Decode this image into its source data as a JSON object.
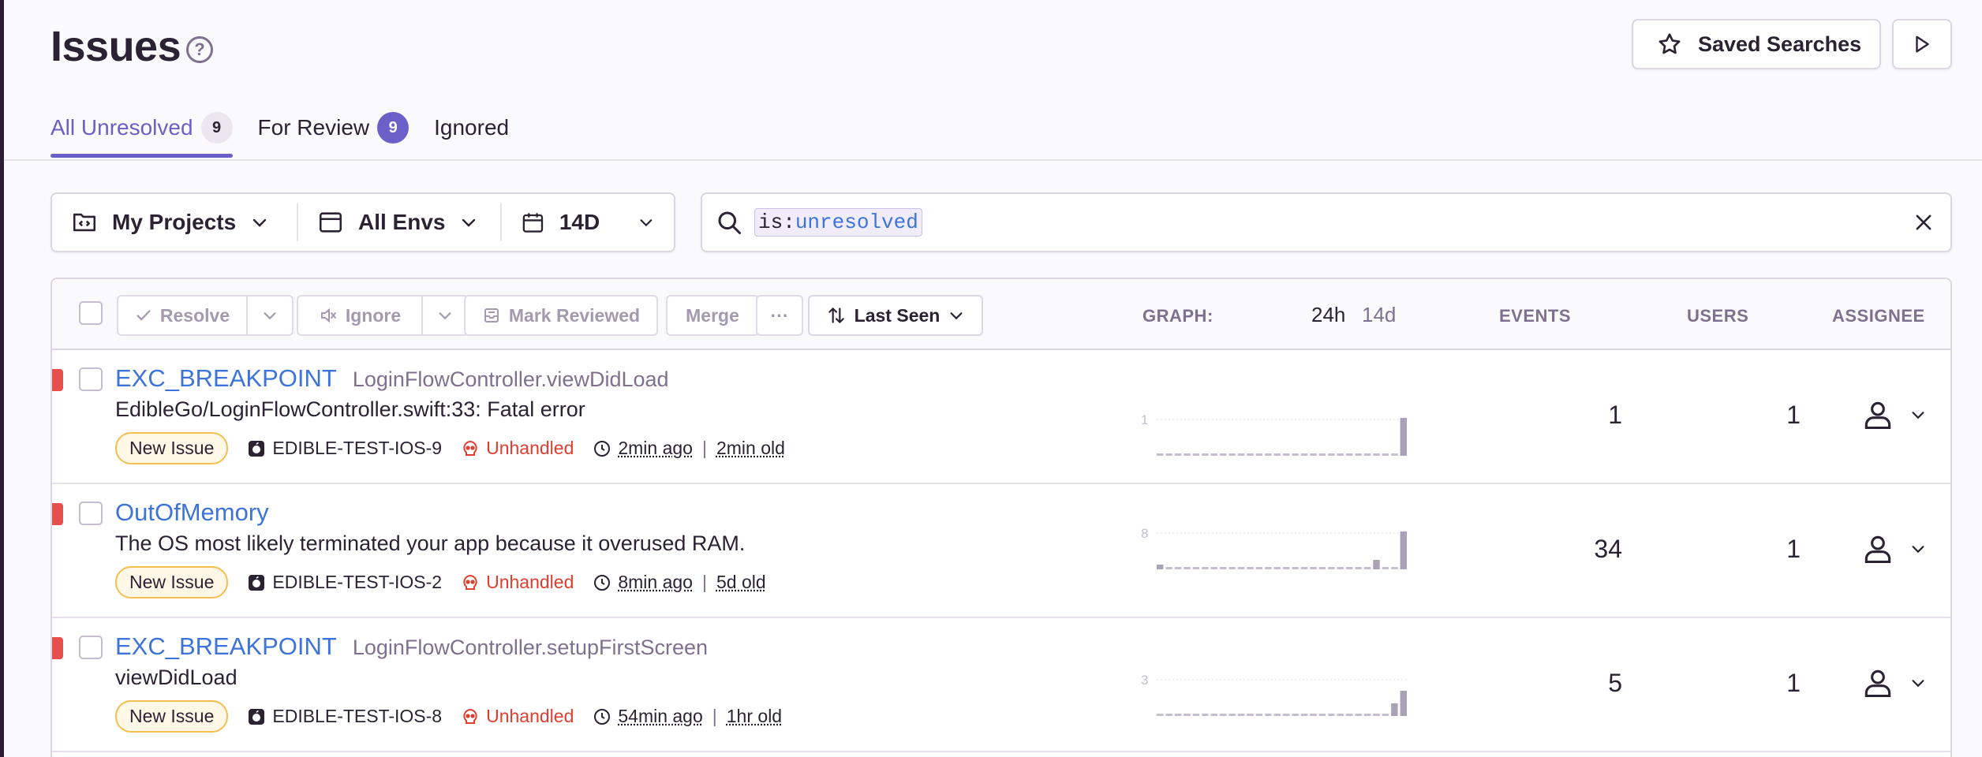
{
  "page": {
    "title": "Issues"
  },
  "header": {
    "saved_searches_label": "Saved Searches"
  },
  "tabs": [
    {
      "label": "All Unresolved",
      "count": "9"
    },
    {
      "label": "For Review",
      "count": "9"
    },
    {
      "label": "Ignored"
    }
  ],
  "filters": {
    "projects": "My Projects",
    "envs": "All Envs",
    "period": "14D"
  },
  "search": {
    "key": "is:",
    "value": "unresolved"
  },
  "toolbar": {
    "resolve": "Resolve",
    "ignore": "Ignore",
    "mark_reviewed": "Mark Reviewed",
    "merge": "Merge",
    "more": "···",
    "sort": "Last Seen"
  },
  "columns": {
    "graph": "GRAPH:",
    "period_24h": "24h",
    "period_14d": "14d",
    "events": "EVENTS",
    "users": "USERS",
    "assignee": "ASSIGNEE"
  },
  "colors": {
    "accent": "#6c5fc7",
    "link": "#3d74db",
    "error": "#e5504c",
    "unhandled": "#e03e2f"
  },
  "issues": [
    {
      "type": "EXC_BREAKPOINT",
      "location": "LoginFlowController.viewDidLoad",
      "message": "EdibleGo/LoginFlowController.swift:33: Fatal error",
      "badge": "New Issue",
      "project": "EDIBLE-TEST-IOS-9",
      "handled": "Unhandled",
      "last_seen": "2min ago",
      "first_seen": "2min old",
      "events": "1",
      "users": "1",
      "graph_max": "1",
      "graph_values": [
        0,
        0,
        0,
        0,
        0,
        0,
        0,
        0,
        0,
        0,
        0,
        0,
        0,
        0,
        0,
        0,
        0,
        0,
        0,
        0,
        0,
        0,
        0,
        0,
        0,
        0,
        0,
        1
      ]
    },
    {
      "type": "OutOfMemory",
      "location": "",
      "message": "The OS most likely terminated your app because it overused RAM.",
      "badge": "New Issue",
      "project": "EDIBLE-TEST-IOS-2",
      "handled": "Unhandled",
      "last_seen": "8min ago",
      "first_seen": "5d old",
      "events": "34",
      "users": "1",
      "graph_max": "8",
      "graph_values": [
        1,
        0,
        0,
        0,
        0,
        0,
        0,
        0,
        0,
        0,
        0,
        0,
        0,
        0,
        0,
        0,
        0,
        0,
        0,
        0,
        0,
        0,
        0,
        0,
        2,
        0,
        0,
        8
      ]
    },
    {
      "type": "EXC_BREAKPOINT",
      "location": "LoginFlowController.setupFirstScreen",
      "message": "viewDidLoad",
      "badge": "New Issue",
      "project": "EDIBLE-TEST-IOS-8",
      "handled": "Unhandled",
      "last_seen": "54min ago",
      "first_seen": "1hr old",
      "events": "5",
      "users": "1",
      "graph_max": "3",
      "graph_values": [
        0,
        0,
        0,
        0,
        0,
        0,
        0,
        0,
        0,
        0,
        0,
        0,
        0,
        0,
        0,
        0,
        0,
        0,
        0,
        0,
        0,
        0,
        0,
        0,
        0,
        0,
        1,
        2
      ]
    }
  ]
}
